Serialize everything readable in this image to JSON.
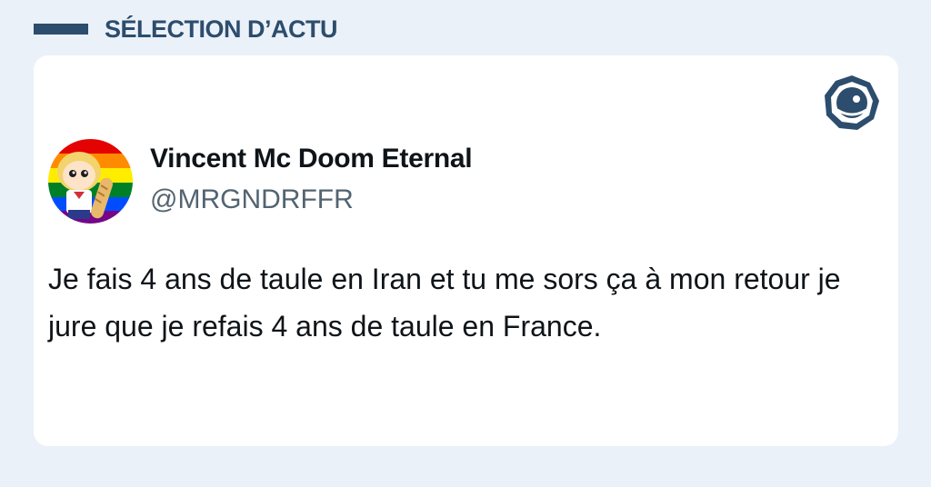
{
  "header": {
    "title": "SÉLECTION D’ACTU",
    "accent_color": "#2c4d6d"
  },
  "tweet": {
    "display_name": "Vincent Mc Doom Eternal",
    "handle": "@MRGNDRFFR",
    "text": "Je fais 4 ans de taule en Iran et tu me sors ça à mon retour je jure que je refais 4 ans de taule en France.",
    "avatar_icon": "pride-flag-cartoon-avatar"
  },
  "brand": {
    "logo_icon": "eye-badge-logo",
    "logo_color": "#2c4d6d"
  }
}
